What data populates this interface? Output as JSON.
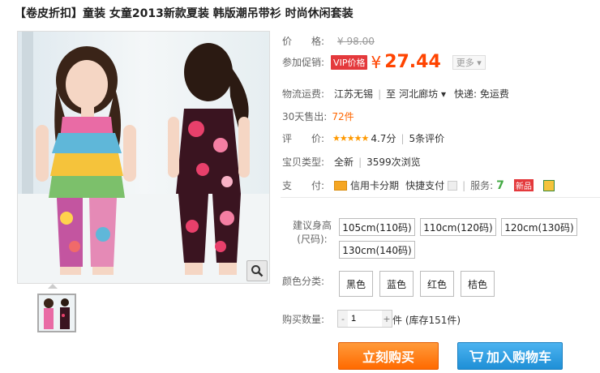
{
  "product": {
    "title": "【卷皮折扣】童装 女童2013新款夏装 韩版潮吊带衫 时尚休闲套装"
  },
  "info": {
    "price_label": "价　　格:",
    "original_price": "¥ 98.00",
    "promo_label": "参加促销:",
    "vip_tag": "VIP价格",
    "currency": "¥",
    "promo_price": "27.44",
    "more_label": "更多 ▾",
    "shipping_label": "物流运费:",
    "ship_from": "江苏无锡",
    "ship_to_sep": "至",
    "ship_to": "河北廊坊 ▾",
    "express": "快递: 免运费",
    "sold_label": "30天售出:",
    "sold_count": "72件",
    "rating_label": "评　　价:",
    "stars": "★★★★★",
    "rating_score": "4.7分",
    "review_count": "5条评价",
    "type_label": "宝贝类型:",
    "condition": "全新",
    "views": "3599次浏览",
    "pay_label": "支　　付:",
    "pay_credit": "信用卡分期",
    "pay_quick": "快捷支付",
    "service_label": "服务:",
    "service_7": "7",
    "service_new": "新品"
  },
  "options": {
    "size_label": "建议身高(尺码):",
    "sizes": [
      "105cm(110码)",
      "110cm(120码)",
      "120cm(130码)",
      "130cm(140码)"
    ],
    "color_label": "颜色分类:",
    "colors": [
      "黑色",
      "蓝色",
      "红色",
      "桔色"
    ]
  },
  "purchase": {
    "qty_label": "购买数量:",
    "qty_value": "1",
    "minus": "-",
    "plus": "+",
    "stock": "件 (库存151件)",
    "buy_now": "立刻购买",
    "add_cart": "加入购物车"
  },
  "colors": {
    "accent": "#ff4400",
    "buy_button": "#ff7a1a",
    "cart_button": "#2b9ae0"
  }
}
